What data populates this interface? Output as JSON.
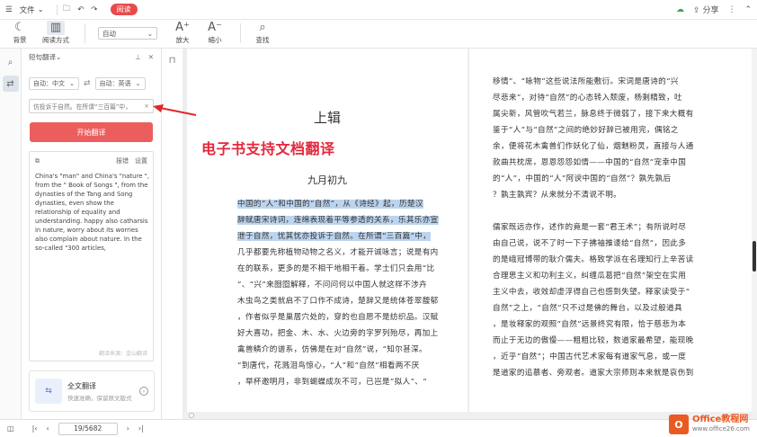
{
  "menubar": {
    "file": "文件",
    "mode_badge": "阅读",
    "share": "分享"
  },
  "ribbon": {
    "background": "背景",
    "reading_mode": "阅读方式",
    "zoom_value": "自动",
    "zoom_in": "放大",
    "zoom_out": "缩小",
    "find": "查找"
  },
  "panel": {
    "title": "短句翻译",
    "source_lang": "自动：中文",
    "target_lang": "自动：英语",
    "source_text": "仿投诉于自然。在所谓“三百篇”中，",
    "translate_button": "开始翻译",
    "report": "报错",
    "settings": "设置",
    "result": "China's \"man\" and China's \"nature \", from the \" Book of Songs \", from the dynasties of the Tang and Song dynasties, even show the relationship of equality and understanding. happy also catharsis in nature, worry about its worries also complain about nature. In the so-called \"300 articles,",
    "result_source": "翻译来源：金山翻译",
    "full_translate_title": "全文翻译",
    "full_translate_desc": "快速准确，保留原文版式"
  },
  "annotation": {
    "title": "电子书支持文档翻译"
  },
  "page_left": {
    "chapter": "上辑",
    "section": "九月初九",
    "lines": [
      {
        "hl": "中国的“人”和中国的“自然”，从《诗经》起，历楚汉",
        "rest": ""
      },
      {
        "hl": "辞赋唐宋诗词，连绵表现着平等参透的关系，乐其乐亦宣",
        "rest": ""
      },
      {
        "hl": "泄于自然，忧其忧亦投诉于自然。在所谓“三百篇”中，",
        "rest": ""
      },
      {
        "hl": "",
        "rest": "几乎都要先称植物动物之名义，才能开诚咏言；说是有内"
      },
      {
        "hl": "",
        "rest": "在的联系，更多的是不相干地相干着。学士们只会用“比"
      },
      {
        "hl": "",
        "rest": "”、“兴”来囫囵解释，不问问何以中国人就这样不涉卉"
      },
      {
        "hl": "",
        "rest": "木虫鸟之类就启不了口作不成诗，楚辞又是统体苍翠馥郁"
      },
      {
        "hl": "",
        "rest": "，作者似乎是巢居穴处的，穿的也自愿不是纺织品。汉赋"
      },
      {
        "hl": "",
        "rest": "好大喜功，把金、木、水、火边旁的字罗列殆尽，再加上"
      },
      {
        "hl": "",
        "rest": "禽兽鳞介的谱系，仿佛是在对“自然”说，“知尔甚深。"
      },
      {
        "hl": "",
        "rest": "”到唐代，花溅泪鸟惊心，“人”和“自然”相看两不厌"
      },
      {
        "hl": "",
        "rest": "，举杯邀明月，非到蝴蝶成灰不可，已岂是“拟人”、“"
      }
    ]
  },
  "page_right": {
    "para1": [
      "移情”、“咏物”这些说法所能敷衍。宋词是唐诗的“兴",
      "尽悲来”，对待“自然”的心态转入颓废，杨剩精致，吐",
      "属尖新，风管吹气若兰，脉息终于微弱了，接下来大概有",
      "鉴于“人”与“自然”之间的绝妙好辞已被用完，偶铭之",
      "余，便将花木禽兽们作妖化了仙，烟魅粉灵，直接与人通",
      "款曲共枕席，恩恩怨怨如情——中国的“自然”宠幸中国",
      "的“人”，中国的“人”阿谀中国的“自然”？孰先孰后",
      "？孰主孰宾？从来就分不清说不明。"
    ],
    "para2": [
      "儒家既远亦作，述作的竟是一套“君王术”；有所说时尽",
      "由自己说，说不了时一下子拂袖推诿给“自然”，因此多",
      "的是峨冠博带的耿介儒夫。格致学派在名理知行上辛苦读",
      "合理思主义和功利主义，纠缠瓜葛把“自然”架空在实用",
      "主义中去，收效却虚浮得自己也感到失望。释家读受于“",
      "自然”之上，“自然”只不过是佛的舞台，以及过般道具",
      "，是妆释家的观照“自然”远景终究有限，恰于慈悲为本",
      "而止于无边的傲慢——粗粗比较，数道家最希望，能现晚",
      "，近乎“自然”；中国古代艺术家每有道家气息，或一度",
      "是道家的追慕者、旁观者。道家大宗师则本来就是哀伤到"
    ]
  },
  "statusbar": {
    "page": "19/5682"
  },
  "watermark": {
    "brand": "Office教程网",
    "url": "www.office26.com"
  }
}
